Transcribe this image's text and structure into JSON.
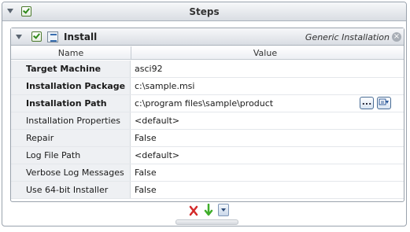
{
  "steps": {
    "title": "Steps",
    "checked": true
  },
  "install": {
    "title": "Install",
    "subtitle": "Generic Installation",
    "checked": true,
    "close_symbol": "×"
  },
  "grid": {
    "columns": [
      "Name",
      "Value"
    ],
    "rows": [
      {
        "name": "Target Machine",
        "value": "asci92",
        "bold": true
      },
      {
        "name": "Installation Package",
        "value": "c:\\sample.msi",
        "bold": true
      },
      {
        "name": "Installation Path",
        "value": "c:\\program files\\sample\\product",
        "bold": true
      },
      {
        "name": "Installation Properties",
        "value": "<default>",
        "bold": false
      },
      {
        "name": "Repair",
        "value": "False",
        "bold": false
      },
      {
        "name": "Log File Path",
        "value": "<default>",
        "bold": false
      },
      {
        "name": "Verbose Log Messages",
        "value": "False",
        "bold": false
      },
      {
        "name": "Use 64-bit Installer",
        "value": "False",
        "bold": false
      }
    ]
  },
  "path_buttons": {
    "browse_label": "...",
    "browse_icon": "ellipsis-icon",
    "variable_icon": "variable-picker-icon"
  },
  "footer": {
    "remove_icon": "remove-step-icon",
    "move_down_icon": "down-arrow-icon",
    "more_icon": "chevron-down-icon"
  },
  "colors": {
    "check": "#2f8a1a",
    "remove": "#d42a2a",
    "move_down": "#3fae2a"
  }
}
